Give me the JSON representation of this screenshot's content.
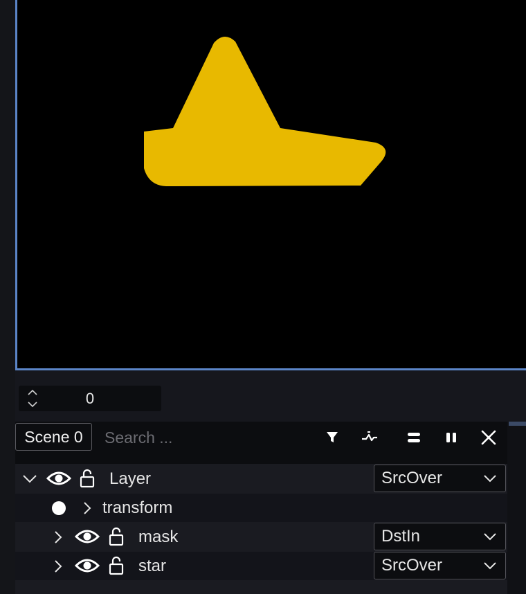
{
  "frame": {
    "value": "0"
  },
  "toolbar": {
    "scene_label": "Scene 0",
    "search_placeholder": "Search ...",
    "icons": [
      "filter-icon",
      "curve-icon",
      "equal-icon",
      "pause-icon",
      "close-icon"
    ]
  },
  "layers": [
    {
      "label": "Layer",
      "blend_mode": "SrcOver",
      "expanded": true
    },
    {
      "label": "transform",
      "property": true
    },
    {
      "label": "mask",
      "blend_mode": "DstIn",
      "expanded": false
    },
    {
      "label": "star",
      "blend_mode": "SrcOver",
      "expanded": false
    }
  ],
  "colors": {
    "shape_fill": "#e8b900",
    "accent": "#5b85c7"
  }
}
